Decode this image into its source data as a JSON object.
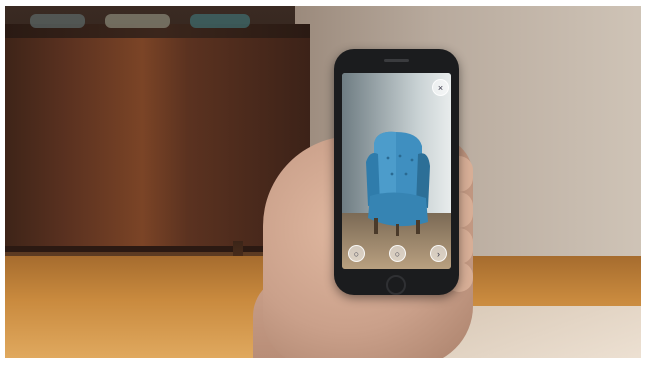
{
  "scene": {
    "description_icons": [
      "armchair-icon",
      "close-icon",
      "camera-icon",
      "info-icon",
      "more-icon"
    ]
  },
  "phone_screen": {
    "buttons": {
      "close": "×",
      "left": "○",
      "center": "○",
      "right": "›"
    }
  },
  "colors": {
    "armchair": "#3f8fc0",
    "armchair_shadow": "#2c6f97",
    "phone_body": "#1b1c1e",
    "wood": "#6b3a22"
  }
}
